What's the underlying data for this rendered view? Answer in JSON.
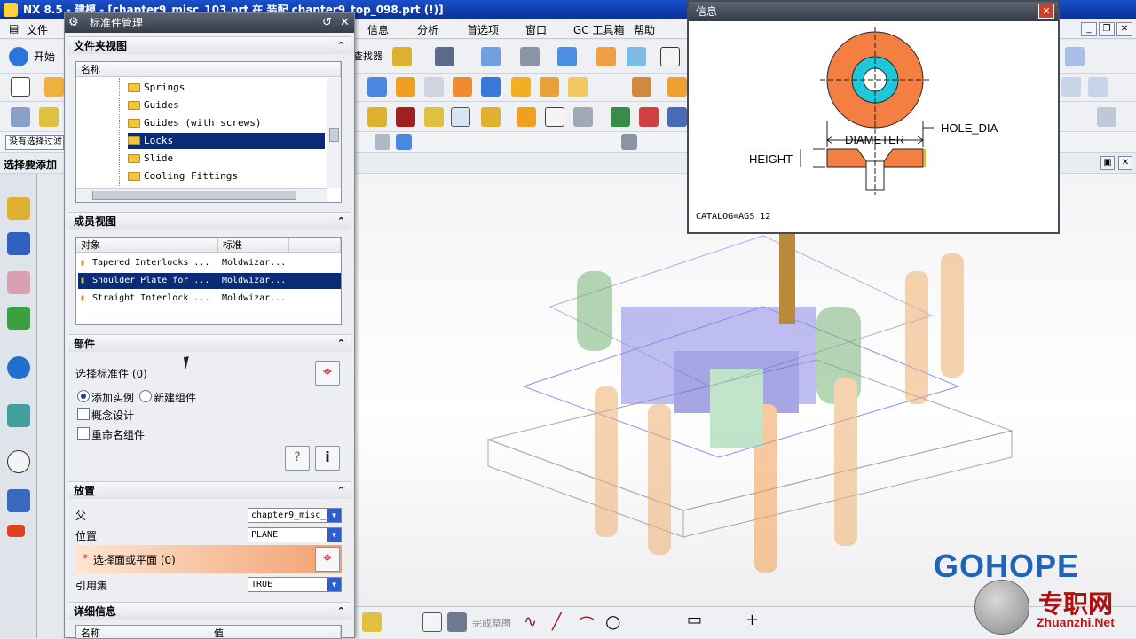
{
  "titlebar": {
    "title": "NX 8.5 - 建模 - [chapter9_misc_103.prt 在 装配 chapter9_top_098.prt    (!)]"
  },
  "menubar": {
    "file": "文件",
    "info": "信息",
    "analysis": "分析",
    "prefs": "首选项",
    "window": "窗口",
    "gc": "GC 工具箱",
    "help": "帮助",
    "start": "开始",
    "finder": "查找器",
    "filter_text": "没有选择过滤",
    "status_text": "选择要添加"
  },
  "dialog": {
    "title": "标准件管理",
    "folder_view": {
      "header": "文件夹视图",
      "column": "名称",
      "items": [
        "Springs",
        "Guides",
        "Guides (with screws)",
        "Locks",
        "Slide",
        "Cooling Fittings"
      ],
      "selected_index": 3
    },
    "member_view": {
      "header": "成员视图",
      "columns": [
        "对象",
        "标准"
      ],
      "rows": [
        {
          "object": "Tapered Interlocks ...",
          "standard": "Moldwizar..."
        },
        {
          "object": "Shoulder Plate for ...",
          "standard": "Moldwizar..."
        },
        {
          "object": "Straight Interlock ...",
          "standard": "Moldwizar..."
        }
      ],
      "selected_index": 1
    },
    "part": {
      "header": "部件",
      "select_label": "选择标准件 (0)",
      "radio_add": "添加实例",
      "radio_new": "新建组件",
      "check_concept": "概念设计",
      "check_rename": "重命名组件"
    },
    "placement": {
      "header": "放置",
      "parent_label": "父",
      "parent_value": "chapter9_misc_",
      "position_label": "位置",
      "position_value": "PLANE",
      "face_label": "选择面或平面 (0)",
      "refset_label": "引用集",
      "refset_value": "TRUE"
    },
    "details": {
      "header": "详细信息",
      "columns": [
        "名称",
        "值"
      ]
    }
  },
  "info_window": {
    "title": "信息",
    "labels": {
      "diameter": "DIAMETER",
      "hole_dia": "HOLE_DIA",
      "height": "HEIGHT"
    },
    "catalog": "CATALOG=AGS 12",
    "colors": {
      "orange": "#f47f42",
      "cyan": "#1ec8d8"
    }
  },
  "watermark": {
    "brand": "GOHOPE",
    "site": "Zhuanzhi.Net",
    "cn": "专职网"
  },
  "bottom": {
    "sketch_label": "完成草图"
  },
  "colors": {
    "title_blue": "#0a2f9a",
    "selected_row": "#0a2b78"
  }
}
